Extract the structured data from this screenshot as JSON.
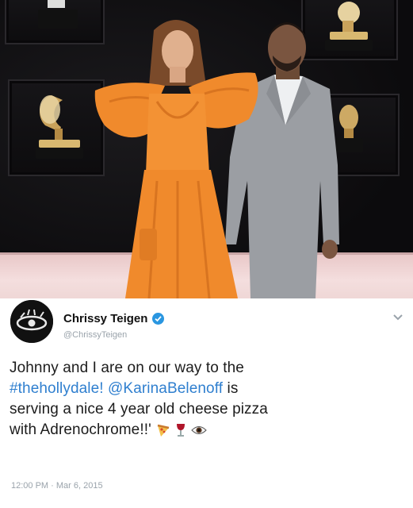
{
  "tweet": {
    "author_name": "Chrissy Teigen",
    "handle": "@ChrissyTeigen",
    "text": {
      "line1": "Johnny and I are on our way to the",
      "hashtag": "#thehollydale!",
      "mention": "@KarinaBelenoff",
      "line2_rest": " is",
      "line3": "serving a nice 4 year old cheese pizza",
      "line4": "with Adrenochrome!!'"
    },
    "timestamp": "12:00 PM · Mar 6, 2015",
    "emoji_icons": [
      "pizza-slice-icon",
      "wine-glass-icon",
      "eye-icon"
    ]
  },
  "colors": {
    "link_blue": "#2f7fcf",
    "verified_blue": "#2a96e0",
    "muted_gray": "#9aa3ab",
    "dress_orange": "#f08a2c"
  }
}
